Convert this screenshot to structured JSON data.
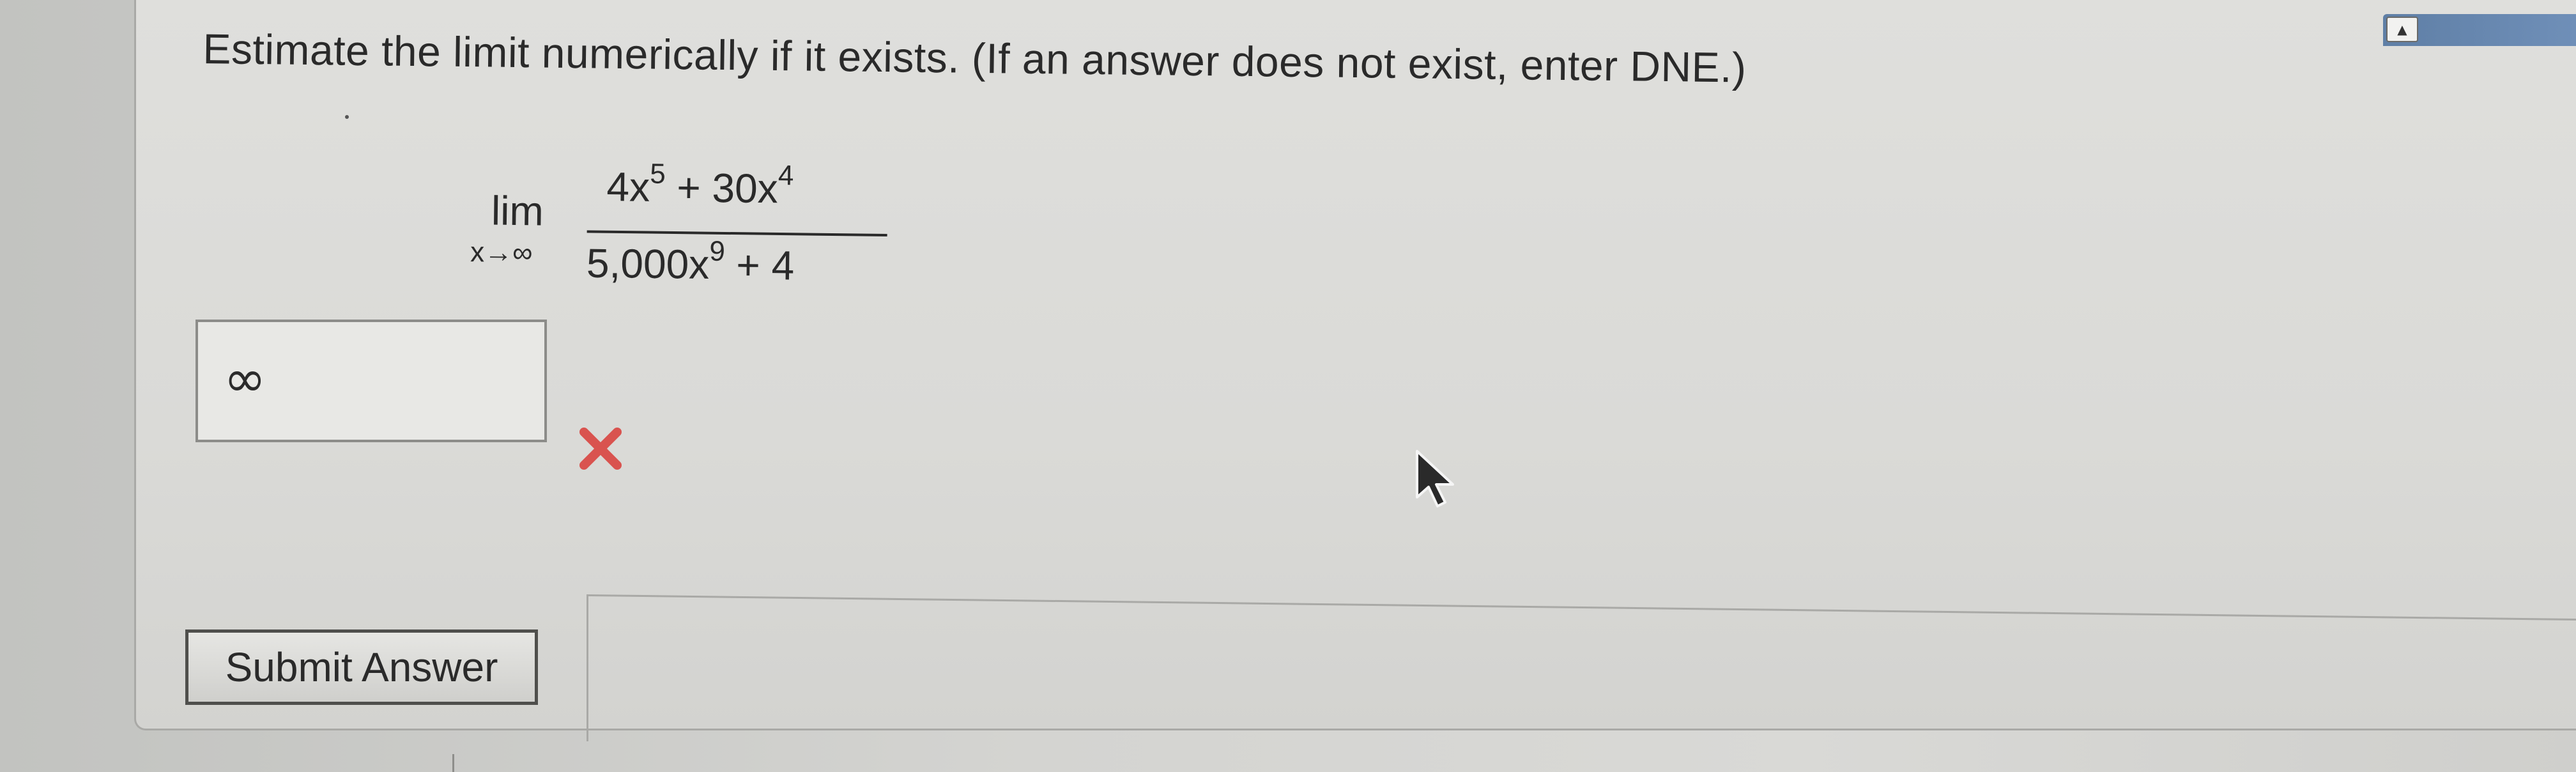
{
  "question": {
    "prompt": "Estimate the limit numerically if it exists. (If an answer does not exist, enter DNE.)"
  },
  "expression": {
    "lim_word": "lim",
    "subscript": "x→∞",
    "numerator_parts": [
      "4x",
      "5",
      " + 30x",
      "4"
    ],
    "denominator_parts": [
      "5,000x",
      "9",
      " + 4"
    ]
  },
  "answer": {
    "value": "∞",
    "status": "incorrect"
  },
  "actions": {
    "submit_label": "Submit Answer"
  },
  "icons": {
    "wrong": "close-icon",
    "cursor": "mouse-pointer-icon",
    "tab": "up-arrow-icon"
  },
  "colors": {
    "wrong_mark": "#d9534f",
    "tab_accent": "#6f8fb8"
  }
}
